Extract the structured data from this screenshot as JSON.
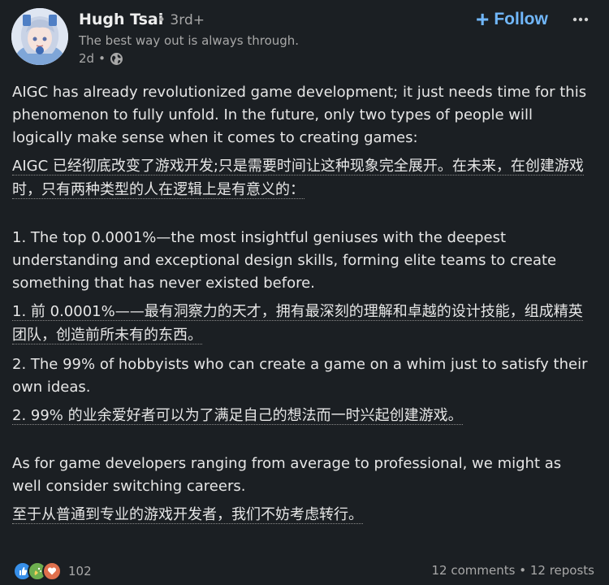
{
  "author": {
    "name": "Hugh Tsai",
    "connection": "• 3rd+",
    "headline": "The best way out is always through.",
    "time": "2d",
    "time_separator": "•",
    "visibility_icon": "globe-icon"
  },
  "actions": {
    "follow_label": "Follow",
    "follow_icon": "+",
    "more_icon": "ellipsis-icon"
  },
  "post": {
    "p1_en": "AIGC has already revolutionized game development; it just needs time for this phenomenon to fully unfold. In the future, only two types of people will logically make sense when it comes to creating games:",
    "p1_zh": "AIGC 已经彻底改变了游戏开发;只是需要时间让这种现象完全展开。在未来，在创建游戏时，只有两种类型的人在逻辑上是有意义的：",
    "p2_en": " 1. The top 0.0001%—the most insightful geniuses with the deepest understanding and exceptional design skills, forming elite teams to create something that has never existed before.",
    "p2_zh": "1. 前 0.0001%——最有洞察力的天才，拥有最深刻的理解和卓越的设计技能，组成精英团队，创造前所未有的东西。",
    "p3_en": " 2. The 99% of hobbyists who can create a game on a whim just to satisfy their own ideas.",
    "p3_zh": "2. 99% 的业余爱好者可以为了满足自己的想法而一时兴起创建游戏。",
    "p4_en": "As for game developers ranging from average to professional, we might as well consider switching careers.",
    "p4_zh": "至于从普通到专业的游戏开发者，我们不妨考虑转行。"
  },
  "footer": {
    "reaction_count": "102",
    "comments": "12 comments",
    "separator": "•",
    "reposts": "12 reposts"
  },
  "colors": {
    "background": "#1b1f23",
    "accent": "#71b7fb",
    "muted_text": "#a8a8a8",
    "like": "#378fe9",
    "celebrate": "#44712e",
    "love": "#df704d"
  }
}
